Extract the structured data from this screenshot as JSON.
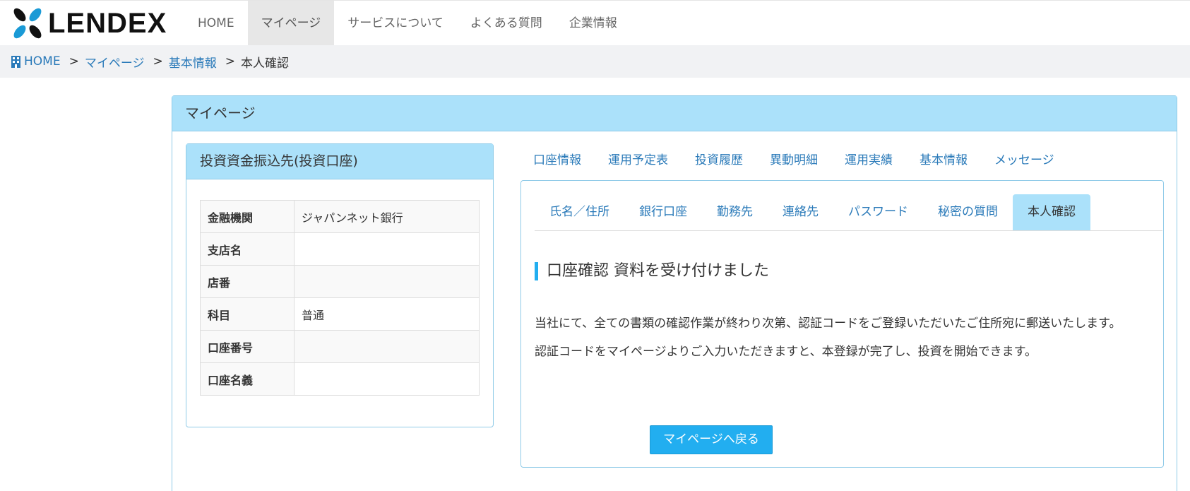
{
  "brand": {
    "name": "LENDEX",
    "logo_colors": [
      "#1a9ad6",
      "#111111"
    ]
  },
  "nav": {
    "items": [
      {
        "label": "HOME"
      },
      {
        "label": "マイページ",
        "active": true
      },
      {
        "label": "サービスについて"
      },
      {
        "label": "よくある質問"
      },
      {
        "label": "企業情報"
      }
    ]
  },
  "breadcrumb": {
    "home_icon": "building-icon",
    "home": "HOME",
    "sep": ">",
    "mypage": "マイページ",
    "basic": "基本情報",
    "current": "本人確認"
  },
  "panel": {
    "title": "マイページ"
  },
  "account_box": {
    "title": "投資資金振込先(投資口座)",
    "rows": [
      {
        "label": "金融機関",
        "value": "ジャパンネット銀行"
      },
      {
        "label": "支店名",
        "value": ""
      },
      {
        "label": "店番",
        "value": ""
      },
      {
        "label": "科目",
        "value": "普通"
      },
      {
        "label": "口座番号",
        "value": ""
      },
      {
        "label": "口座名義",
        "value": ""
      }
    ]
  },
  "main_tabs": [
    {
      "label": "口座情報"
    },
    {
      "label": "運用予定表"
    },
    {
      "label": "投資履歴"
    },
    {
      "label": "異動明細"
    },
    {
      "label": "運用実績"
    },
    {
      "label": "基本情報"
    },
    {
      "label": "メッセージ"
    }
  ],
  "sub_tabs": [
    {
      "label": "氏名／住所"
    },
    {
      "label": "銀行口座"
    },
    {
      "label": "勤務先"
    },
    {
      "label": "連絡先"
    },
    {
      "label": "パスワード"
    },
    {
      "label": "秘密の質問"
    },
    {
      "label": "本人確認",
      "active": true
    }
  ],
  "content": {
    "heading": "口座確認 資料を受け付けました",
    "message_1": "当社にて、全ての書類の確認作業が終わり次第、認証コードをご登録いただいたご住所宛に郵送いたします。",
    "message_2": "認証コードをマイページよりご入力いただきますと、本登録が完了し、投資を開始できます。",
    "back_button": "マイページへ戻る"
  },
  "colors": {
    "accent": "#22aef0",
    "header_bg": "#abe1fa",
    "link": "#2a7ab9",
    "border": "#90cbe8"
  }
}
